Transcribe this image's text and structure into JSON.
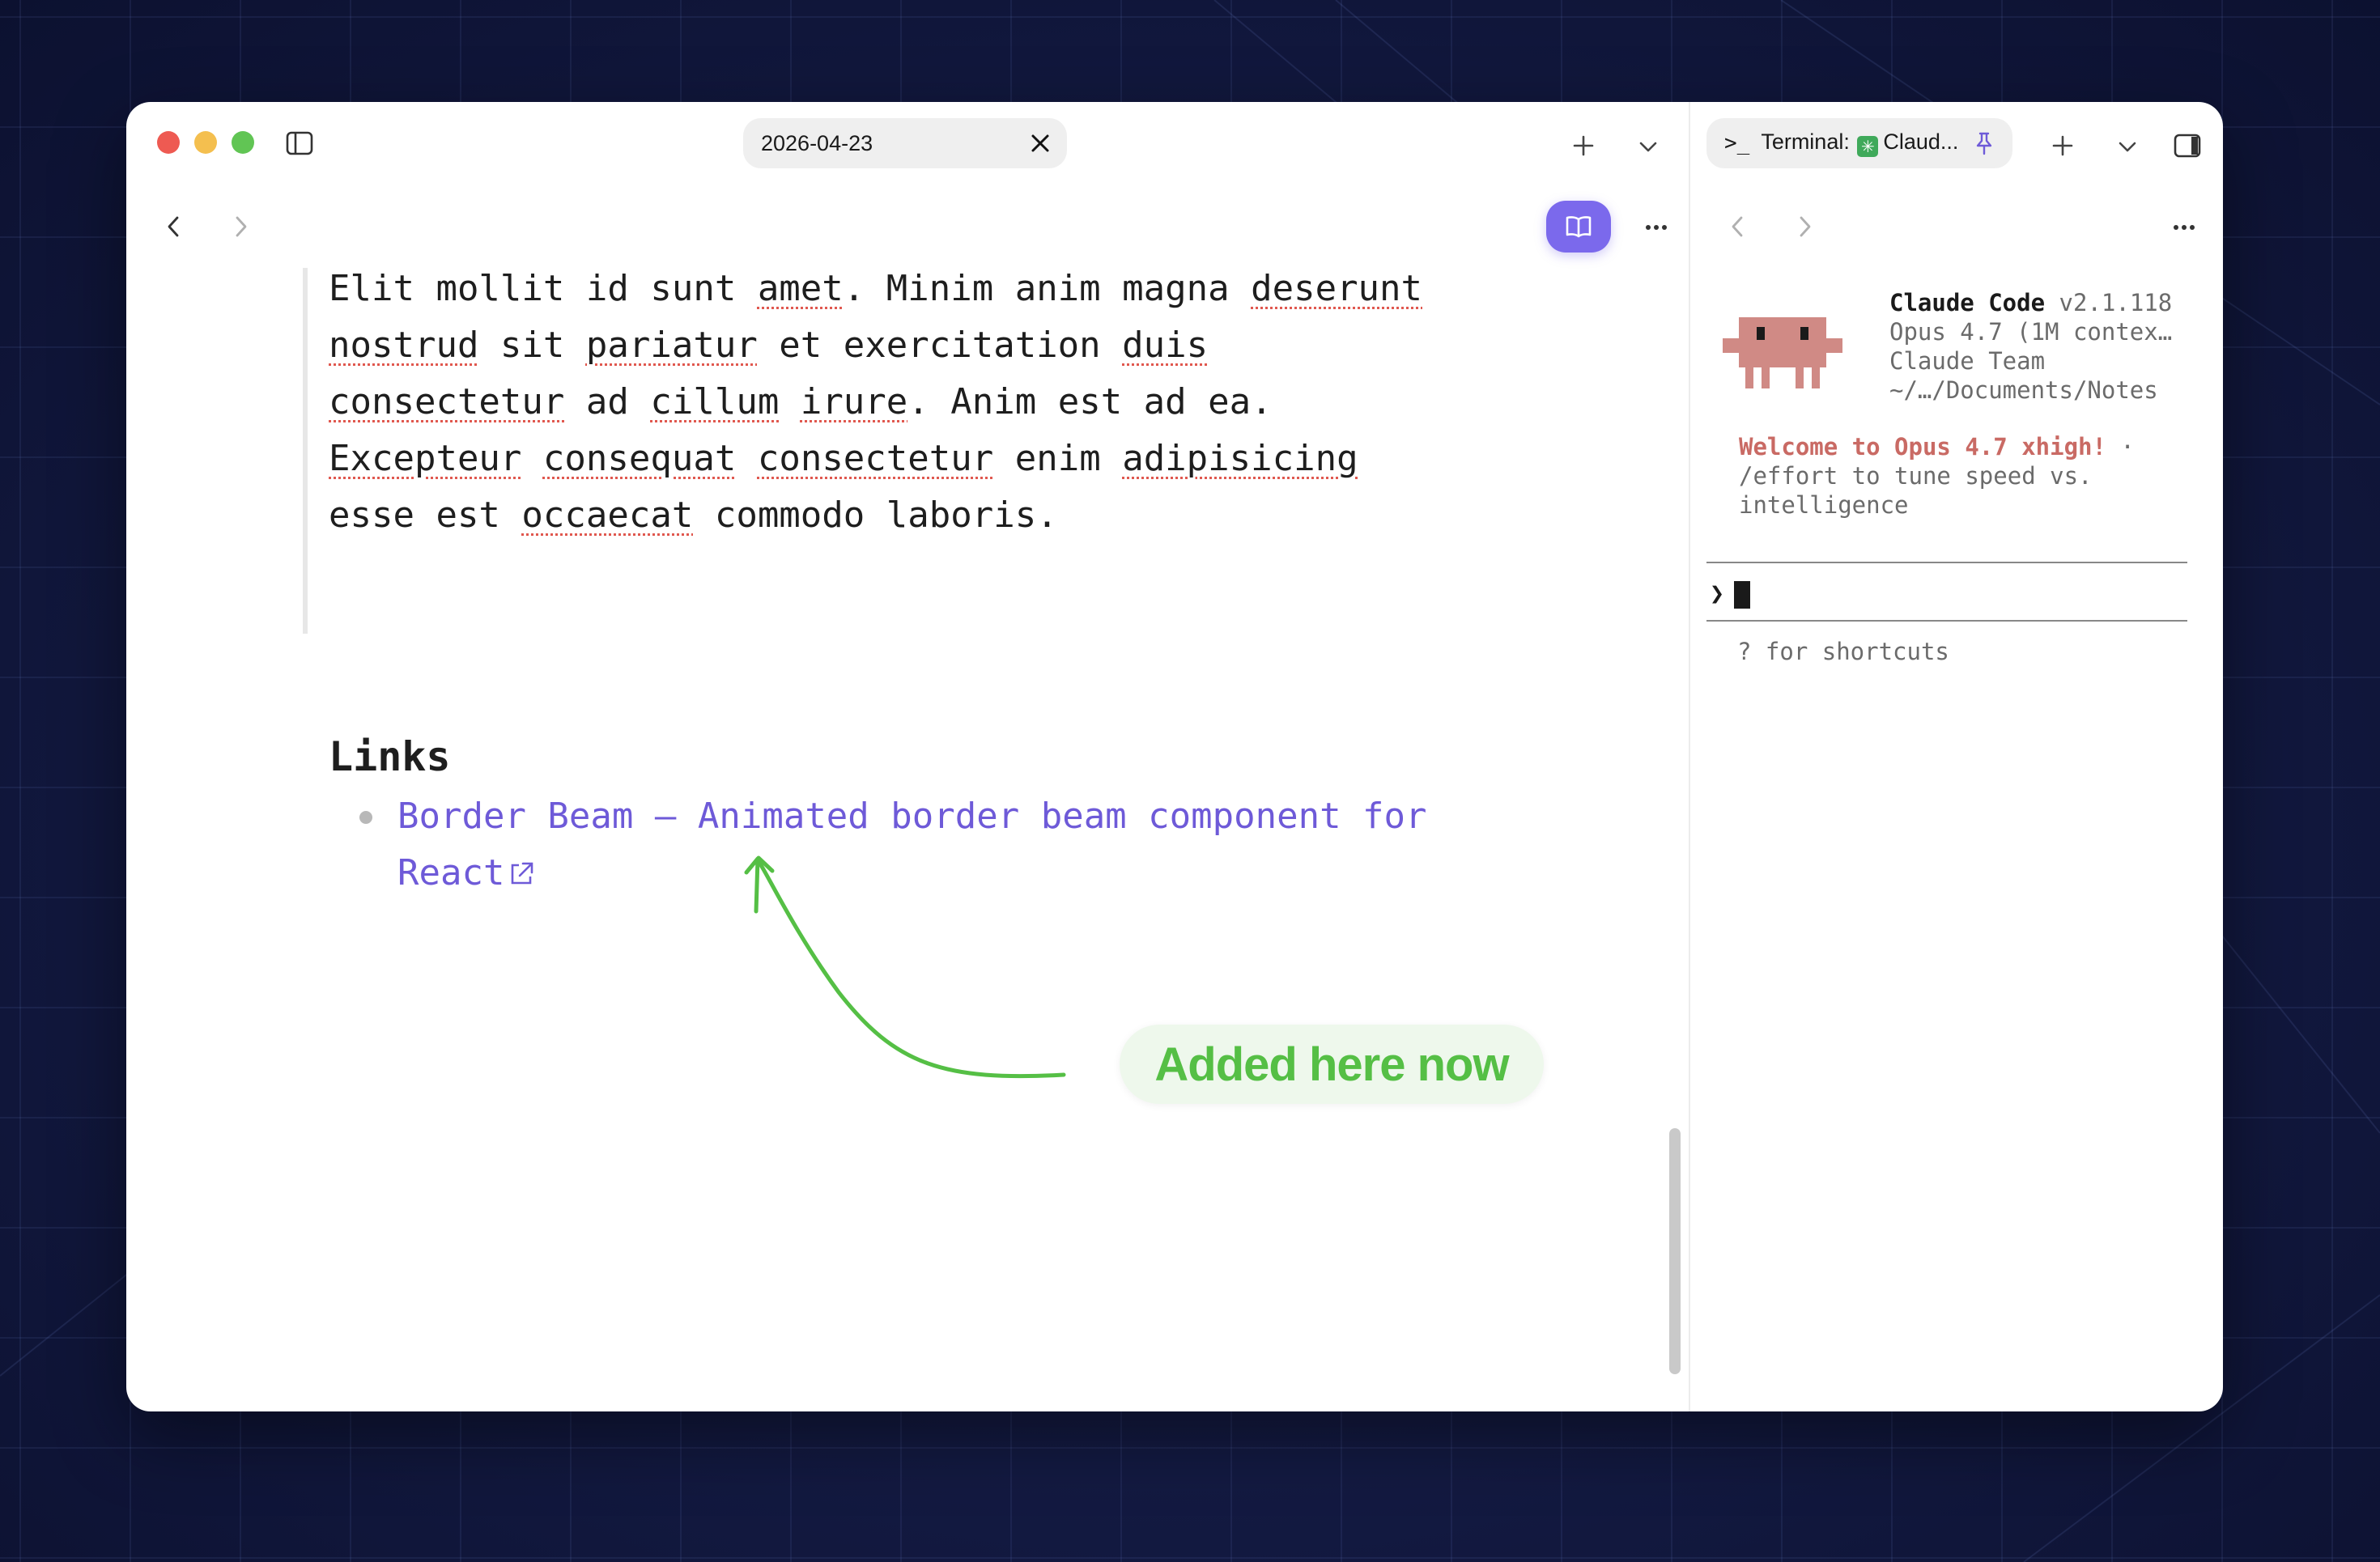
{
  "window": {
    "tab_title": "2026-04-23"
  },
  "note": {
    "quote_lines": [
      [
        {
          "t": "Elit mollit id sunt "
        },
        {
          "t": "amet",
          "s": 1
        },
        {
          "t": ". Minim anim magna "
        },
        {
          "t": "deserunt",
          "s": 1
        }
      ],
      [
        {
          "t": "nostrud",
          "s": 1
        },
        {
          "t": " sit "
        },
        {
          "t": "pariatur",
          "s": 1
        },
        {
          "t": " et exercitation "
        },
        {
          "t": "duis",
          "s": 1
        }
      ],
      [
        {
          "t": "consectetur",
          "s": 1
        },
        {
          "t": " ad "
        },
        {
          "t": "cillum",
          "s": 1
        },
        {
          "t": " "
        },
        {
          "t": "irure",
          "s": 1
        },
        {
          "t": ". Anim est ad ea."
        }
      ],
      [
        {
          "t": "Excepteur",
          "s": 1
        },
        {
          "t": " "
        },
        {
          "t": "consequat",
          "s": 1
        },
        {
          "t": " "
        },
        {
          "t": "consectetur",
          "s": 1
        },
        {
          "t": " enim "
        },
        {
          "t": "adipisicing",
          "s": 1
        }
      ],
      [
        {
          "t": "esse est "
        },
        {
          "t": "occaecat",
          "s": 1
        },
        {
          "t": " commodo laboris."
        }
      ]
    ],
    "links_heading": "Links",
    "link_line1": "Border Beam – Animated border beam component for",
    "link_line2": "React"
  },
  "annotation": {
    "label": "Added here now",
    "color": "#55bf45"
  },
  "terminal": {
    "tab_prefix": ">_",
    "tab_title": "Terminal: ",
    "tab_title_suffix": "Claud...",
    "app_name": "Claude Code",
    "version": " v2.1.118",
    "model": "Opus 4.7 (1M contex…",
    "org": "Claude Team",
    "path": "~/…/Documents/Notes",
    "welcome_highlight": "Welcome to Opus 4.7 xhigh!",
    "welcome_rest": " · /effort to tune speed vs. intelligence",
    "prompt": "❯",
    "hint": "? for shortcuts"
  },
  "colors": {
    "accent": "#7b69ec",
    "link": "#6e5ad8",
    "spellcheck": "#e0584f",
    "mascot": "#d08a85"
  }
}
